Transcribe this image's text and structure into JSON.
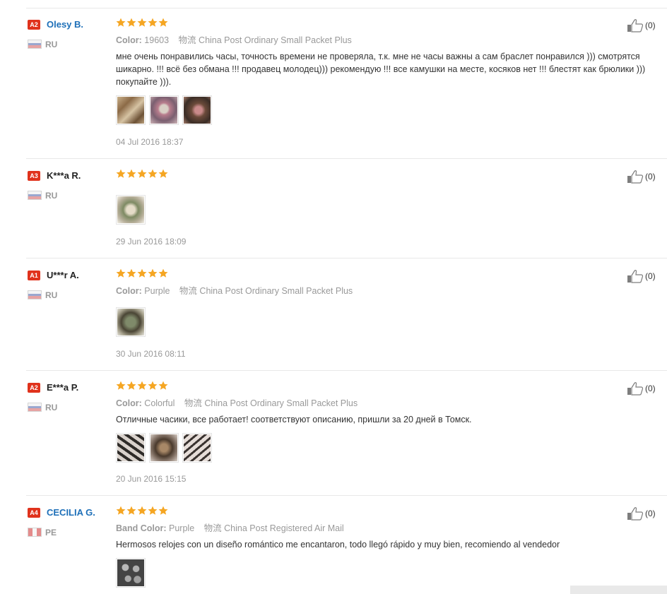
{
  "colors": {
    "star": "#f5a623",
    "level_badge": "#e0321c",
    "name_link": "#1d6fb8"
  },
  "reviews": [
    {
      "level": "A2",
      "name": "Olesy B.",
      "country": "RU",
      "stars": 5,
      "option_label": "Color:",
      "option_value": "19603",
      "logistics_label": "物流",
      "logistics_value": "China Post Ordinary Small Packet Plus",
      "text": "мне очень понравились часы, точность времени не проверяла, т.к. мне не часы важны а сам браслет понравился ))) смотрятся шикарно. !!! всё без обмана !!! продавец молодец))) рекомендую !!! все камушки на месте, косяков нет !!! блестят как брюлики ))) покупайте ))).",
      "date": "04 Jul 2016 18:37",
      "likes": "(0)"
    },
    {
      "level": "A3",
      "name": "K***a R.",
      "country": "RU",
      "stars": 5,
      "date": "29 Jun 2016 18:09",
      "likes": "(0)"
    },
    {
      "level": "A1",
      "name": "U***r A.",
      "country": "RU",
      "stars": 5,
      "option_label": "Color:",
      "option_value": "Purple",
      "logistics_label": "物流",
      "logistics_value": "China Post Ordinary Small Packet Plus",
      "date": "30 Jun 2016 08:11",
      "likes": "(0)"
    },
    {
      "level": "A2",
      "name": "E***a P.",
      "country": "RU",
      "stars": 5,
      "option_label": "Color:",
      "option_value": "Colorful",
      "logistics_label": "物流",
      "logistics_value": "China Post Ordinary Small Packet Plus",
      "text": "Отличные часики, все работает! соответствуют описанию, пришли за 20 дней в Томск.",
      "date": "20 Jun 2016 15:15",
      "likes": "(0)"
    },
    {
      "level": "A4",
      "name": "CECILIA G.",
      "country": "PE",
      "stars": 5,
      "option_label": "Band Color:",
      "option_value": "Purple",
      "logistics_label": "物流",
      "logistics_value": "China Post Registered Air Mail",
      "text": "Hermosos relojes con un diseño romántico me encantaron, todo llegó rápido y muy bien, recomiendo al vendedor",
      "likes": "(0)"
    }
  ]
}
